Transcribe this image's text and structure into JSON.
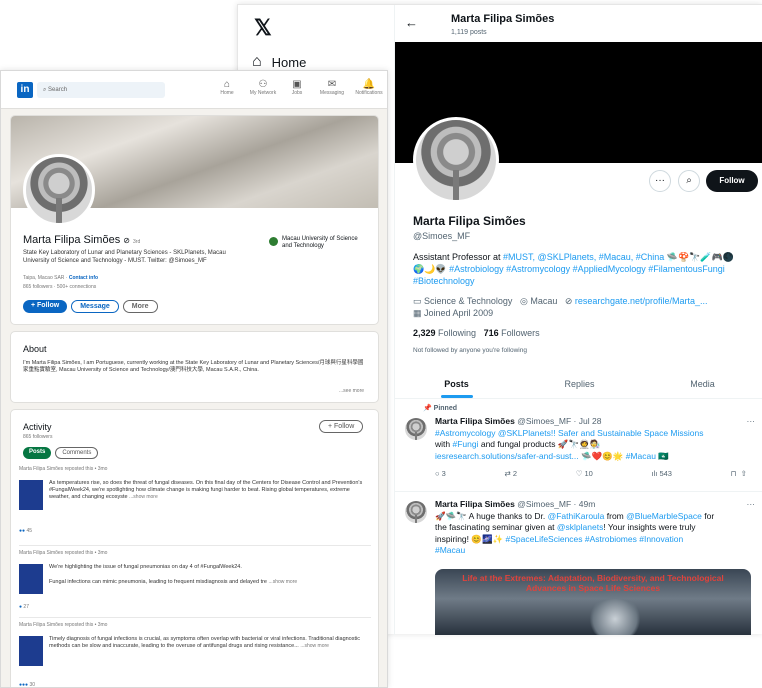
{
  "x": {
    "nav_home": "Home",
    "profile_name": "Marta Filipa Simões",
    "posts_count": "1,119 posts",
    "follow": "Follow",
    "display_name": "Marta Filipa Simões",
    "handle": "@Simoes_MF",
    "bio_plain": "Assistant Professor at ",
    "bio_links1": "#MUST, @SKLPlanets, #Macau, #China",
    "bio_tags2": "#Astrobiology #Astromycology #AppliedMycology #FilamentousFungi",
    "bio_tags3": "#Biotechnology",
    "category": "Science & Technology",
    "location": "Macau",
    "website": "researchgate.net/profile/Marta_...",
    "joined": "Joined April 2009",
    "following_num": "2,329",
    "following_label": "Following",
    "followers_num": "716",
    "followers_label": "Followers",
    "not_followed": "Not followed by anyone you're following",
    "tabs": [
      "Posts",
      "Replies",
      "Media"
    ],
    "pinned": "Pinned",
    "tweet1": {
      "name": "Marta Filipa Simões",
      "meta": "@Simoes_MF · Jul 28",
      "l1": "#Astromycology @SKLPlanets!! Safer and Sustainable Space Missions",
      "l2a": "with ",
      "l2b": "#Fungi",
      "l2c": " and fungal products",
      "l3": "iesresearch.solutions/safer-and-sust...",
      "l3b": "#Macau",
      "replies": "3",
      "retweets": "2",
      "likes": "10",
      "views": "543"
    },
    "tweet2": {
      "name": "Marta Filipa Simões",
      "meta": "@Simoes_MF · 49m",
      "l1a": "A huge thanks to Dr. ",
      "l1b": "@FathiKaroula",
      "l1c": " from ",
      "l1d": "@BlueMarbleSpace",
      "l1e": " for",
      "l2": "the fascinating seminar given at ",
      "l2b": "@sklplanets",
      "l2c": "! Your insights were truly",
      "l3": "inspiring! ",
      "l3b": "#SpaceLifeSciences #Astrobiomes #Innovation",
      "l4": "#Macau",
      "banner1": "Life at the Extremes: Adaptation, Biodiversity, and Technological",
      "banner2": "Advances in Space Life Sciences"
    }
  },
  "li": {
    "search_placeholder": "Search",
    "nav": [
      "Home",
      "My Network",
      "Jobs",
      "Messaging",
      "Notifications"
    ],
    "name": "Marta Filipa Simões",
    "degree": "3rd",
    "headline": "State Key Laboratory of Lunar and Planetary Sciences - SKLPlanets, Macau University of Science and Technology - MUST. Twitter: @Simoes_MF",
    "location": "Taipa, Macao SAR",
    "contact": "Contact info",
    "followers": "865 followers · 500+ connections",
    "org": "Macau University of Science and Technology",
    "btn_follow": "+ Follow",
    "btn_message": "Message",
    "btn_more": "More",
    "about_title": "About",
    "about_text": "I'm Marta Filipa Simões, I am Portuguese, currently working at the State Key Laboratory of Lunar and Planetary Sciences/月球與行星科學國家重點實驗室, Macau University of Science and Technology/澳門科技大學, Macau S.A.R., China.",
    "see_more": "...see more",
    "activity_title": "Activity",
    "activity_sub": "865 followers",
    "activity_follow": "+ Follow",
    "filter_posts": "Posts",
    "filter_comments": "Comments",
    "repost_line": "Marta Filipa Simões reposted this • 3mo",
    "post1": "As temperatures rise, so does the threat of fungal diseases. On this final day of the Centers for Disease Control and Prevention's #FungalWeek24, we're spotlighting how climate change is making fungi harder to beat. Rising global temperatures, extreme weather, and changing ecosyste",
    "post1_count": "45",
    "post2a": "We're highlighting the issue of fungal pneumonias on day 4 of #FungalWeek24.",
    "post2b": "Fungal infections can mimic pneumonia, leading to frequent misdiagnosis and delayed tre",
    "post2_count": "27",
    "post3": "Timely diagnosis of fungal infections is crucial, as symptoms often overlap with bacterial or viral infections. Traditional diagnostic methods can be slow and inaccurate, leading to the overuse of antifungal drugs and rising resistance...",
    "post3_count": "30",
    "show_more": "...show more"
  },
  "colors": {
    "x_blue": "#1d9bf0",
    "li_blue": "#0a66c2",
    "li_green": "#057642"
  },
  "icons": [
    "x-logo-icon",
    "home-icon",
    "back-arrow-icon",
    "more-icon",
    "search-icon",
    "linkedin-logo-icon",
    "bell-icon",
    "calendar-icon",
    "pin-icon",
    "reply-icon",
    "retweet-icon",
    "heart-icon",
    "views-icon",
    "bookmark-icon",
    "share-icon"
  ]
}
